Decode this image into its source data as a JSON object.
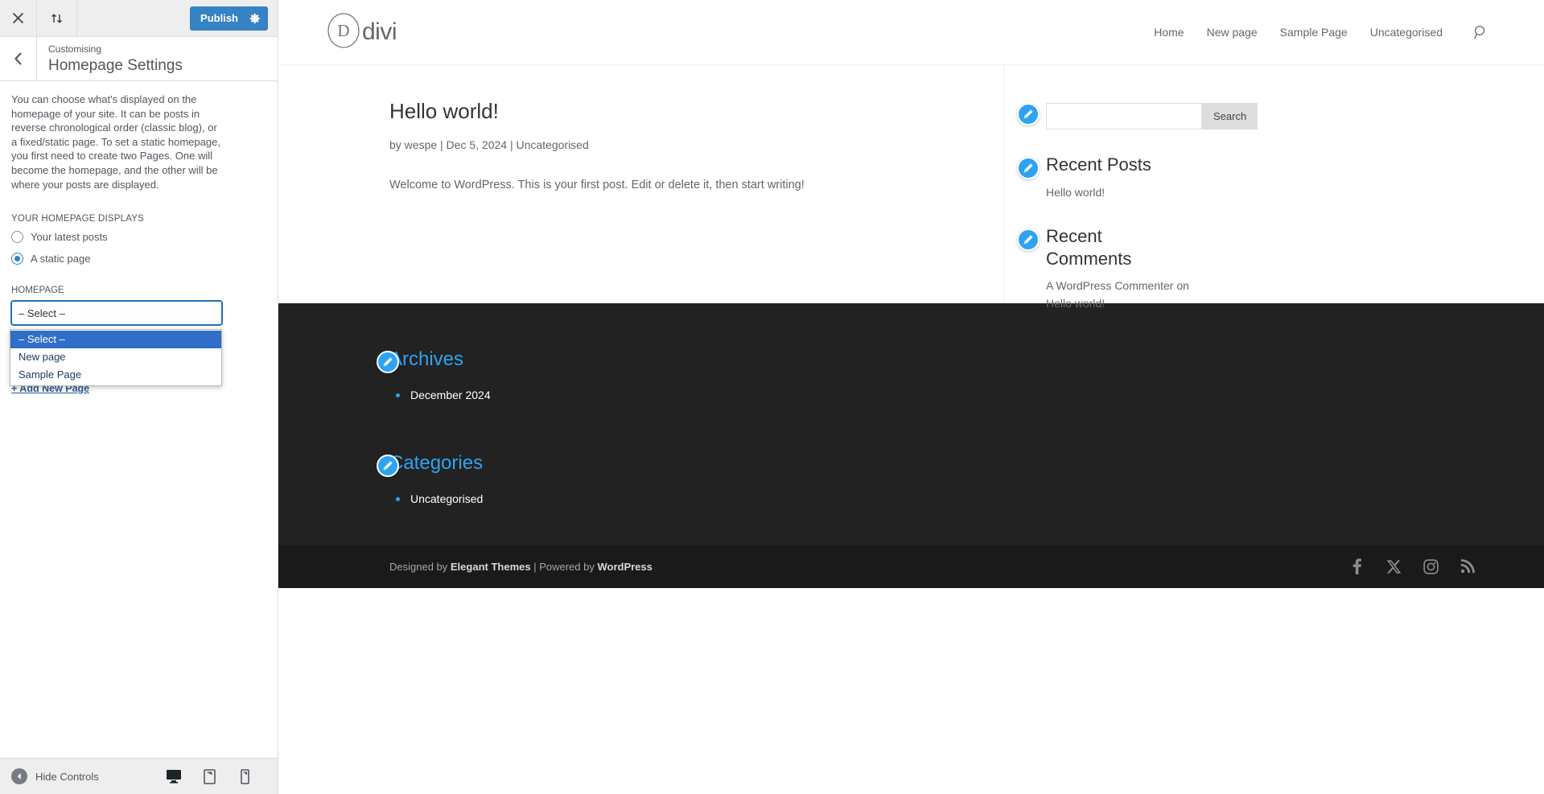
{
  "customizer": {
    "topbar": {
      "close_icon": "close-icon",
      "devices_toggle_icon": "collapse-arrows-icon",
      "publish_label": "Publish",
      "publish_gear_icon": "gear-icon"
    },
    "header": {
      "back_icon": "chevron-left-icon",
      "eyebrow": "Customising",
      "title": "Homepage Settings"
    },
    "description": "You can choose what's displayed on the homepage of your site. It can be posts in reverse chronological order (classic blog), or a fixed/static page. To set a static homepage, you first need to create two Pages. One will become the homepage, and the other will be where your posts are displayed.",
    "displays_legend": "YOUR HOMEPAGE DISPLAYS",
    "radios": [
      {
        "label": "Your latest posts",
        "checked": false
      },
      {
        "label": "A static page",
        "checked": true
      }
    ],
    "homepage_label": "HOMEPAGE",
    "homepage_select_value": "– Select –",
    "posts_page_select_value": "– Select –",
    "dropdown_open": true,
    "dropdown_options": [
      {
        "label": "– Select –",
        "selected": true
      },
      {
        "label": "New page",
        "selected": false
      },
      {
        "label": "Sample Page",
        "selected": false
      }
    ],
    "add_new_page_label": "+ Add New Page",
    "bottom": {
      "hide_controls_label": "Hide Controls",
      "hide_icon": "left-arrow-circle-icon",
      "devices": [
        {
          "name": "desktop-preview-icon",
          "active": true
        },
        {
          "name": "tablet-preview-icon",
          "active": false
        },
        {
          "name": "mobile-preview-icon",
          "active": false
        }
      ]
    },
    "colors": {
      "accent": "#3582c4",
      "focus_border": "#2271b1",
      "dropdown_highlight": "#2f6fc7"
    }
  },
  "preview": {
    "site_header": {
      "logo_text": "divi",
      "logo_mark": "circled-d-logo",
      "nav": [
        {
          "label": "Home"
        },
        {
          "label": "New page"
        },
        {
          "label": "Sample Page"
        },
        {
          "label": "Uncategorised"
        }
      ],
      "search_icon": "search-icon"
    },
    "post": {
      "title": "Hello world!",
      "meta": "by wespe | Dec 5, 2024 | Uncategorised",
      "body": "Welcome to WordPress. This is your first post. Edit or delete it, then start writing!"
    },
    "sidebar": {
      "search_widget": {
        "edit_icon": "edit-pencil-icon",
        "input_value": "",
        "input_placeholder": "",
        "button_label": "Search"
      },
      "widgets": [
        {
          "edit_icon": "edit-pencil-icon",
          "title": "Recent Posts",
          "items": [
            "Hello world!"
          ]
        },
        {
          "edit_icon": "edit-pencil-icon",
          "title": "Recent Comments",
          "items": [
            "A WordPress Commenter on Hello world!"
          ]
        }
      ]
    },
    "footer": {
      "widgets": [
        {
          "edit_icon": "edit-pencil-icon",
          "title": "Archives",
          "items": [
            "December 2024"
          ]
        },
        {
          "edit_icon": "edit-pencil-icon",
          "title": "Categories",
          "items": [
            "Uncategorised"
          ]
        }
      ],
      "credit_prefix": "Designed by ",
      "credit_theme": "Elegant Themes",
      "credit_middle": " | Powered by ",
      "credit_cms": "WordPress",
      "social": [
        {
          "name": "facebook-icon"
        },
        {
          "name": "x-twitter-icon"
        },
        {
          "name": "instagram-icon"
        },
        {
          "name": "rss-icon"
        }
      ]
    },
    "colors": {
      "accent": "#2ea3f2",
      "footer_bg": "#222222",
      "footer_bottom_bg": "#1a1a1a"
    }
  }
}
